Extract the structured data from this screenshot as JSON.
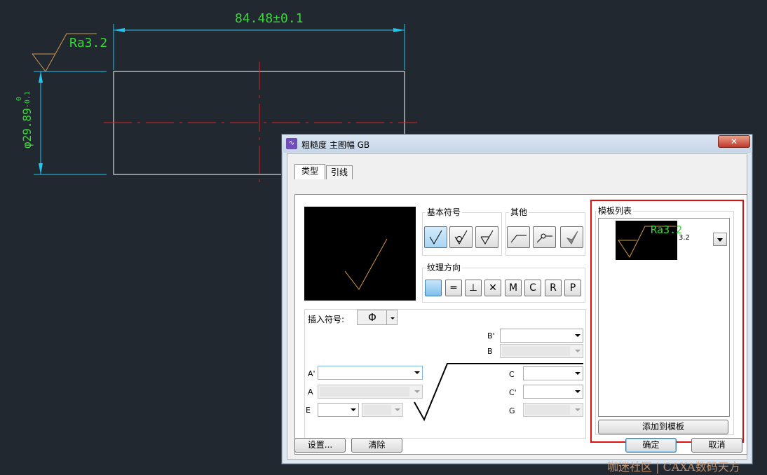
{
  "cad": {
    "dimension_width": "84.48±0.1",
    "roughness_label": "Ra3.2",
    "dimension_height_base": "φ29.89",
    "dimension_height_tol_upper": "0",
    "dimension_height_tol_lower": "-0.1",
    "colors": {
      "background": "#212830",
      "geometry": "#ffffff",
      "dimension": "#21c7f0",
      "text": "#39d839",
      "centerline": "#e02020",
      "symbol": "#d39a4d"
    }
  },
  "dialog": {
    "title": "粗糙度 主图幅 GB",
    "close_label": "✕",
    "tabs": [
      {
        "label": "类型",
        "active": true
      },
      {
        "label": "引线",
        "active": false
      }
    ],
    "basic_symbol_label": "基本符号",
    "other_label": "其他",
    "texture_label": "纹理方向",
    "texture_buttons": [
      "",
      "═",
      "⊥",
      "✕",
      "M",
      "C",
      "R",
      "P"
    ],
    "insert_symbol_label": "插入符号:",
    "insert_symbol_value": "Φ",
    "fields": {
      "b_prime": "B'",
      "b": "B",
      "a_prime": "A'",
      "a": "A",
      "e": "E",
      "c": "C",
      "c_prime": "C'",
      "g": "G"
    },
    "template": {
      "label": "模板列表",
      "item_text": "Ra3.2",
      "item_value": "3.2",
      "add_button": "添加到模板"
    },
    "buttons": {
      "settings": "设置...",
      "clear": "清除",
      "ok": "确定",
      "cancel": "取消"
    }
  },
  "watermark": "咖迷社区 | CAXA数码天方"
}
